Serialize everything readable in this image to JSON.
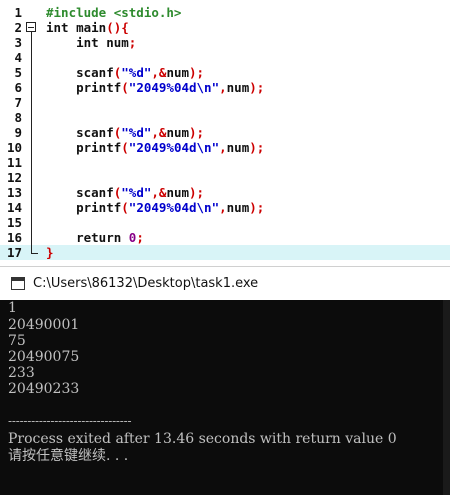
{
  "editor": {
    "lines": [
      {
        "n": "1",
        "t": "#include <stdio.h>"
      },
      {
        "n": "2",
        "t": "int main(){"
      },
      {
        "n": "3",
        "t": "    int num;"
      },
      {
        "n": "4",
        "t": ""
      },
      {
        "n": "5",
        "t": "    scanf(\"%d\",&num);"
      },
      {
        "n": "6",
        "t": "    printf(\"2049%04d\\n\",num);"
      },
      {
        "n": "7",
        "t": ""
      },
      {
        "n": "8",
        "t": ""
      },
      {
        "n": "9",
        "t": "    scanf(\"%d\",&num);"
      },
      {
        "n": "10",
        "t": "    printf(\"2049%04d\\n\",num);"
      },
      {
        "n": "11",
        "t": ""
      },
      {
        "n": "12",
        "t": ""
      },
      {
        "n": "13",
        "t": "    scanf(\"%d\",&num);"
      },
      {
        "n": "14",
        "t": "    printf(\"2049%04d\\n\",num);"
      },
      {
        "n": "15",
        "t": ""
      },
      {
        "n": "16",
        "t": "    return 0;"
      },
      {
        "n": "17",
        "t": "}"
      }
    ],
    "highlight_line": 17,
    "colors": {
      "keyword": "#111111",
      "preprocessor": "#2e8b2e",
      "string": "#0000cc",
      "punct": "#cc0000",
      "number": "#880088",
      "highlight": "#d8f4f7"
    }
  },
  "console": {
    "title": "C:\\Users\\86132\\Desktop\\task1.exe",
    "icon": "console-window-icon",
    "output": [
      "1",
      "20490001",
      "75",
      "20490075",
      "233",
      "20490233"
    ],
    "separator": "--------------------------------",
    "exit_message": "Process exited after 13.46 seconds with return value 0",
    "prompt": "请按任意键继续. . ."
  }
}
